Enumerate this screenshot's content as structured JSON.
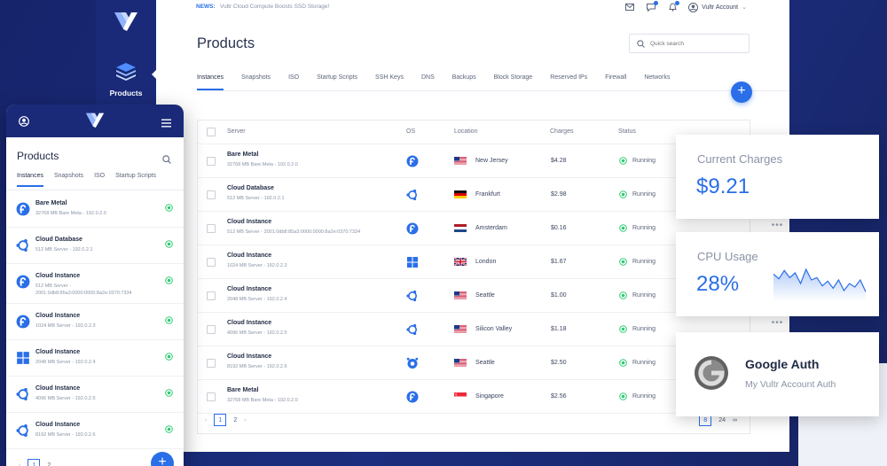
{
  "colors": {
    "accent": "#2a6ee8",
    "brand_dark": "#1a2a78",
    "running": "#2ecc71"
  },
  "sidebar": {
    "label": "Products",
    "icon": "layers-icon"
  },
  "topbar": {
    "news_label": "NEWS:",
    "news_text": "Vultr Cloud Compute Boosts SSD Storage!",
    "account": "Vultr Account"
  },
  "main": {
    "title": "Products",
    "search_placeholder": "Quick search",
    "tabs": [
      "Instances",
      "Snapshots",
      "ISO",
      "Startup Scripts",
      "SSH Keys",
      "DNS",
      "Backups",
      "Block Storage",
      "Reserved IPs",
      "Firewall",
      "Networks"
    ],
    "add_label": "+",
    "columns": {
      "server": "Server",
      "os": "OS",
      "location": "Location",
      "charges": "Charges",
      "status": "Status"
    },
    "rows": [
      {
        "name": "Bare Metal",
        "sub": "32768 MB Bare Meta - 192.0.2.0",
        "os": "fedora-icon",
        "location": "New Jersey",
        "flag": "us",
        "charges": "$4.28",
        "status": "Running"
      },
      {
        "name": "Cloud Database",
        "sub": "512 MB Server - 192.0.2.1",
        "os": "ubuntu-icon",
        "location": "Frankfurt",
        "flag": "de",
        "charges": "$2.98",
        "status": "Running"
      },
      {
        "name": "Cloud Instance",
        "sub": "512 MB Server - 2001:0db8:85a3:0000:0000:8a2e:0370:7334",
        "os": "fedora-icon",
        "location": "Amsterdam",
        "flag": "nl",
        "charges": "$0.16",
        "status": "Running"
      },
      {
        "name": "Cloud Instance",
        "sub": "1024 MB Server - 192.0.2.3",
        "os": "windows-icon",
        "location": "London",
        "flag": "gb",
        "charges": "$1.67",
        "status": "Running"
      },
      {
        "name": "Cloud Instance",
        "sub": "2048 MB Server - 192.0.2.4",
        "os": "ubuntu-icon",
        "location": "Seattle",
        "flag": "us",
        "charges": "$1.00",
        "status": "Running"
      },
      {
        "name": "Cloud Instance",
        "sub": "4096 MB Server - 192.0.2.5",
        "os": "ubuntu-icon",
        "location": "Silicon Valley",
        "flag": "us",
        "charges": "$1.18",
        "status": "Running"
      },
      {
        "name": "Cloud Instance",
        "sub": "8192 MB Server - 192.0.2.6",
        "os": "freebsd-icon",
        "location": "Seattle",
        "flag": "us",
        "charges": "$2.50",
        "status": "Running"
      },
      {
        "name": "Bare Metal",
        "sub": "32768 MB Bare Meta - 192.0.2.0",
        "os": "fedora-icon",
        "location": "Singapore",
        "flag": "sg",
        "charges": "$2.56",
        "status": "Running"
      }
    ],
    "pager": {
      "prev": "‹",
      "page1": "1",
      "page2": "2",
      "next": "›"
    },
    "per_page": {
      "a": "8",
      "b": "24",
      "c": "∞"
    }
  },
  "mobile": {
    "title": "Products",
    "tabs": [
      "Instances",
      "Snapshots",
      "ISO",
      "Startup Scripts"
    ],
    "items": [
      {
        "name": "Bare Metal",
        "sub": "32768 MB Bare Meta - 192.0.2.0",
        "os": "fedora-icon"
      },
      {
        "name": "Cloud Database",
        "sub": "512 MB Server - 192.0.2.1",
        "os": "ubuntu-icon"
      },
      {
        "name": "Cloud Instance",
        "sub": "512 MB Server - 2001:0db8:85a3:0000:0000:8a2e:0370:7334",
        "os": "fedora-icon"
      },
      {
        "name": "Cloud Instance",
        "sub": "1024 MB Server - 192.0.2.3",
        "os": "fedora-icon"
      },
      {
        "name": "Cloud Instance",
        "sub": "2048 MB Server - 192.0.2.4",
        "os": "windows-icon"
      },
      {
        "name": "Cloud Instance",
        "sub": "4096 MB Server - 192.0.2.5",
        "os": "ubuntu-icon"
      },
      {
        "name": "Cloud Instance",
        "sub": "8192 MB Server - 192.0.2.6",
        "os": "ubuntu-icon"
      }
    ],
    "pager": {
      "prev": "‹",
      "page1": "1",
      "page2": "2"
    },
    "add_label": "+"
  },
  "cards": {
    "charges": {
      "label": "Current Charges",
      "value": "$9.21",
      "more": "•••"
    },
    "cpu": {
      "label": "CPU Usage",
      "value": "28%",
      "more": "•••",
      "trend": [
        30,
        26,
        33,
        27,
        31,
        22,
        34,
        25,
        27,
        20,
        24,
        18,
        25,
        16,
        22,
        19,
        25,
        15
      ]
    },
    "auth": {
      "title": "Google Auth",
      "subtitle": "My Vultr Account Auth"
    }
  }
}
